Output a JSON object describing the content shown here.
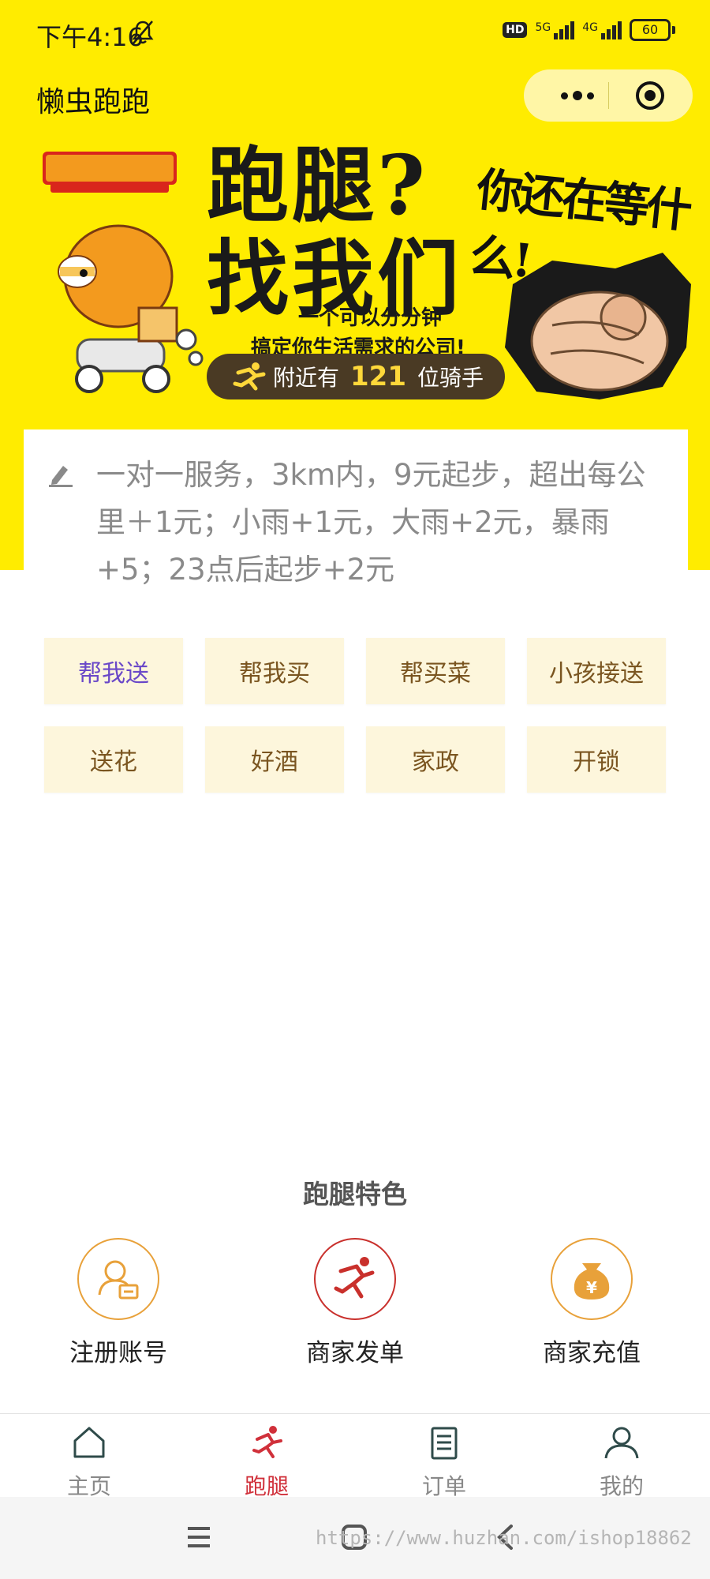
{
  "status_bar": {
    "time": "下午4:16",
    "hd": "HD",
    "net1": "5G",
    "net2": "4G",
    "battery": "60"
  },
  "nav": {
    "title": "懒虫跑跑"
  },
  "banner": {
    "headline_line1": "跑腿?",
    "headline_line2": "找我们",
    "slogan": "你还在等什么!",
    "sub_line1": "一个可以分分钟",
    "sub_line2": "搞定你生活需求的公司!",
    "riders_prefix": "附近有",
    "riders_count": "121",
    "riders_suffix": "位骑手"
  },
  "notice": {
    "text": "一对一服务，3km内，9元起步，超出每公里＋1元；小雨+1元，大雨+2元，暴雨+5；23点后起步+2元"
  },
  "services": [
    {
      "label": "帮我送",
      "active": true
    },
    {
      "label": "帮我买"
    },
    {
      "label": "帮买菜"
    },
    {
      "label": "小孩接送"
    },
    {
      "label": "送花"
    },
    {
      "label": "好酒"
    },
    {
      "label": "家政"
    },
    {
      "label": "开锁"
    }
  ],
  "features": {
    "title": "跑腿特色",
    "items": [
      {
        "label": "注册账号",
        "icon": "user-card-icon",
        "color": "#E8A13A"
      },
      {
        "label": "商家发单",
        "icon": "runner-icon",
        "color": "#C9302C"
      },
      {
        "label": "商家充值",
        "icon": "money-bag-icon",
        "color": "#E8A13A"
      }
    ]
  },
  "tabbar": {
    "items": [
      {
        "label": "主页",
        "icon": "home-icon"
      },
      {
        "label": "跑腿",
        "icon": "runner-icon",
        "active": true
      },
      {
        "label": "订单",
        "icon": "order-list-icon"
      },
      {
        "label": "我的",
        "icon": "user-icon"
      }
    ]
  },
  "system_nav": {
    "watermark": "https://www.huzhan.com/ishop18862"
  },
  "colors": {
    "brand_yellow": "#FFEC00",
    "accent_red": "#D0303A",
    "service_bg": "#FDF6DC"
  }
}
